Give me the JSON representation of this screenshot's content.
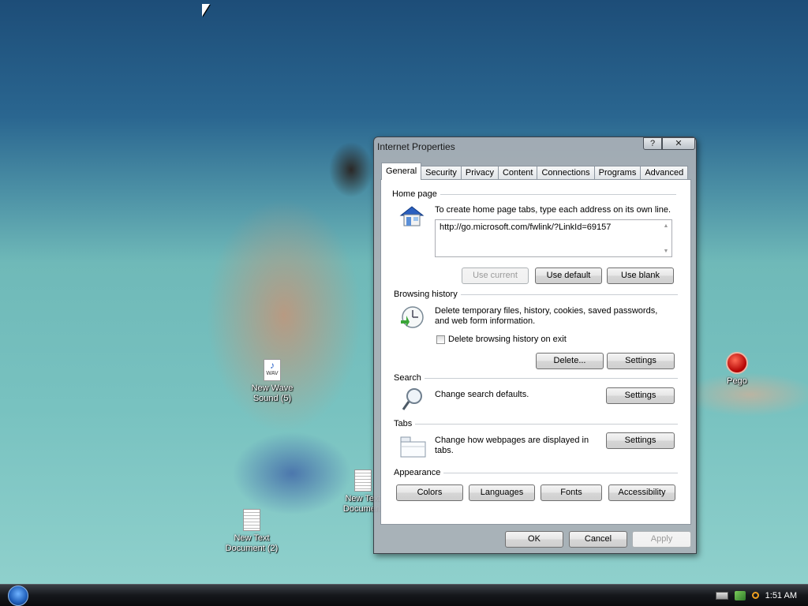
{
  "desktop": {
    "icons": [
      {
        "label": "New Wave Sound (5)"
      },
      {
        "label": "New Text Document (2)"
      },
      {
        "label": "New Text Document"
      },
      {
        "label": "Pego"
      }
    ]
  },
  "dialog": {
    "title": "Internet Properties",
    "help_label": "?",
    "close_label": "✕",
    "tabs": [
      "General",
      "Security",
      "Privacy",
      "Content",
      "Connections",
      "Programs",
      "Advanced"
    ],
    "active_tab": "General",
    "home_page": {
      "heading": "Home page",
      "description": "To create home page tabs, type each address on its own line.",
      "url": "http://go.microsoft.com/fwlink/?LinkId=69157",
      "buttons": [
        "Use current",
        "Use default",
        "Use blank"
      ]
    },
    "browsing_history": {
      "heading": "Browsing history",
      "description": "Delete temporary files, history, cookies, saved passwords, and web form information.",
      "checkbox_label": "Delete browsing history on exit",
      "checkbox_checked": false,
      "buttons": [
        "Delete...",
        "Settings"
      ]
    },
    "search": {
      "heading": "Search",
      "description": "Change search defaults.",
      "button": "Settings"
    },
    "tabs_section": {
      "heading": "Tabs",
      "description": "Change how webpages are displayed in tabs.",
      "button": "Settings"
    },
    "appearance": {
      "heading": "Appearance",
      "buttons": [
        "Colors",
        "Languages",
        "Fonts",
        "Accessibility"
      ]
    },
    "footer": {
      "ok": "OK",
      "cancel": "Cancel",
      "apply": "Apply"
    }
  },
  "taskbar": {
    "clock": "1:51 AM"
  }
}
